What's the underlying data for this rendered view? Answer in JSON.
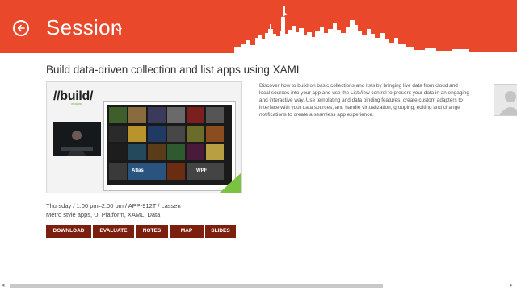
{
  "header": {
    "title": "Session",
    "back_icon": "back-arrow-icon",
    "chevron_icon": "chevron-down-icon",
    "accent_color": "#e9482a"
  },
  "session": {
    "heading": "Build data-driven collection and list apps using XAML",
    "description": "Discover how to build on basic collections and lists by bringing live data from cloud and local sources into your app and use the ListView control to present your data in an engaging and interactive way. Use templating and data binding features, create custom adapters to interface with your data sources, and handle virtualization, grouping, editing and change notifications to create a seamless app experience.",
    "metadata": "Thursday  /  1:00 pm–2:00 pm  /  APP-912T  /  Lassen",
    "tags": "Metro style apps, UI Platform, XAML, Data"
  },
  "video": {
    "logo_text": "//build/",
    "logo_sub": "windows",
    "tile_labels": [
      "Atlas",
      "WPF"
    ]
  },
  "actions": {
    "download": "DOWNLOAD",
    "evaluate": "EVALUATE",
    "notes": "NOTES",
    "map": "MAP",
    "slides": "SLIDES",
    "button_color": "#7d1f0e"
  },
  "avatar": {
    "icon": "person-silhouette-icon"
  }
}
